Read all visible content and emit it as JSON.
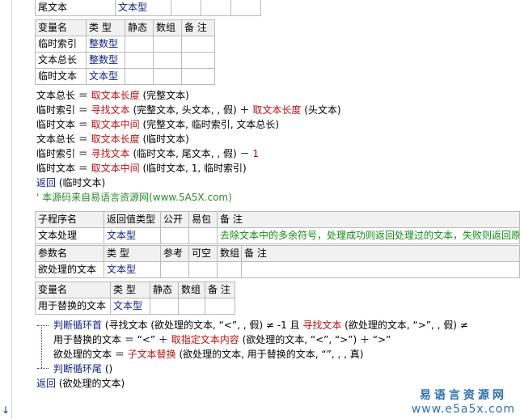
{
  "top_row": {
    "label": "尾文本",
    "type": "文本型"
  },
  "local_vars_1": {
    "headers": [
      "变量名",
      "类 型",
      "静态",
      "数组",
      "备 注"
    ],
    "rows": [
      {
        "name": "临时索引",
        "type": "整数型"
      },
      {
        "name": "文本总长",
        "type": "整数型"
      },
      {
        "name": "临时文本",
        "type": "文本型"
      }
    ]
  },
  "code_1": [
    "文本总长 ＝ ",
    "临时索引 ＝ ",
    "临时文本 ＝ ",
    "文本总长 ＝ ",
    "临时索引 ＝ ",
    "临时文本 ＝ "
  ],
  "code_1_fn": [
    "取文本长度",
    "寻找文本",
    "取文本中间",
    "取文本长度",
    "寻找文本",
    "取文本中间"
  ],
  "code_1_args": [
    " (完整文本)",
    " (完整文本, 头文本, , 假) ＋ ",
    " (完整文本, 临时索引, 文本总长)",
    " (临时文本)",
    " (临时文本, 尾文本, , 假) － ",
    " (临时文本, 1, 临时索引)"
  ],
  "code_1_extra": {
    "fn": "取文本长度",
    "args": " (头文本)",
    "num": "1"
  },
  "return_1": {
    "kw": "返回",
    "args": " (临时文本)"
  },
  "comment": "' 本源码来自易语言资源网(www.5A5X.com)",
  "sub_header": {
    "headers": [
      "子程序名",
      "返回值类型",
      "公开",
      "易包",
      "备 注"
    ],
    "name": "文本处理",
    "ret_type": "文本型",
    "note": "去除文本中的多余符号，处理成功则返回处理过的文本，失败则返回原"
  },
  "params": {
    "headers": [
      "参数名",
      "类 型",
      "参考",
      "可空",
      "数组",
      "备 注"
    ],
    "name": "欲处理的文本",
    "type": "文本型"
  },
  "local_vars_2": {
    "headers": [
      "变量名",
      "类 型",
      "静态",
      "数组",
      "备 注"
    ],
    "name": "用于替换的文本",
    "type": "文本型"
  },
  "loop": {
    "line1_kw": "判断循环首",
    "line1_a": " (寻找文本 (欲处理的文本, “<”, , 假) ≠ -1 且 ",
    "line1_fn": "寻找文本",
    "line1_b": " (欲处理的文本, “>”, , 假) ≠",
    "line2_a": "用于替换的文本 ＝ “<” ＋ ",
    "line2_fn": "取指定文本内容",
    "line2_b": " (欲处理的文本, “<”, “>”) ＋ “>”",
    "line3_a": "欲处理的文本 ＝ ",
    "line3_fn": "子文本替换",
    "line3_b": " (欲处理的文本, 用于替换的文本, “”, , , 真)",
    "line4_kw": "判断循环尾",
    "line4_b": " ()"
  },
  "return_2": {
    "kw": "返回",
    "args": " (欲处理的文本)"
  },
  "watermark": {
    "cn": "易语言资源网",
    "en": "www.e5a5x.com"
  }
}
